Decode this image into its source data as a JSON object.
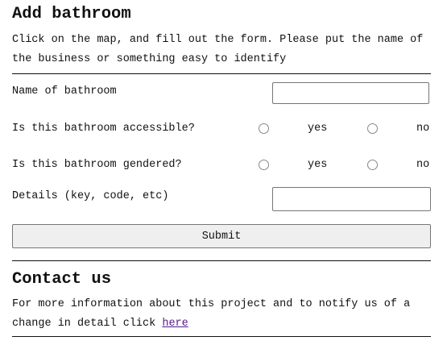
{
  "add_section": {
    "title": "Add bathroom",
    "instructions": "Click on the map, and fill out the form. Please put the name of the business or something easy to identify"
  },
  "form": {
    "name_label": "Name of bathroom",
    "name_value": "",
    "accessible_label": "Is this bathroom accessible?",
    "gendered_label": "Is this bathroom gendered?",
    "yes_label": "yes",
    "no_label": "no",
    "details_label": "Details (key, code, etc)",
    "details_value": "",
    "submit_label": "Submit"
  },
  "contact_section": {
    "title": "Contact us",
    "text": "For more information about this project and to notify us of a change in detail click ",
    "link_label": "here"
  }
}
